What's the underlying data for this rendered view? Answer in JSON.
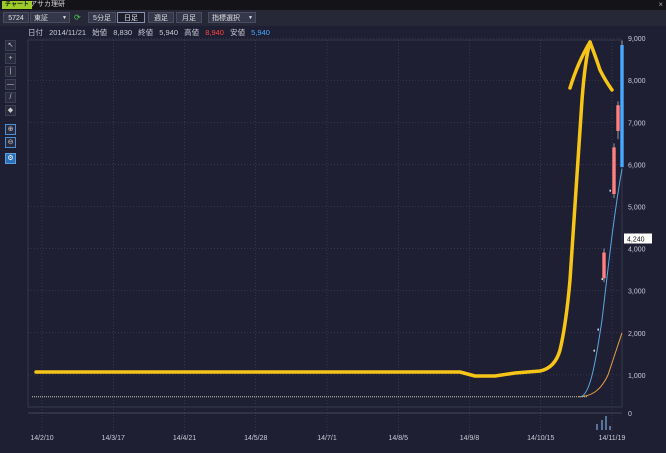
{
  "window": {
    "badge": "チャート",
    "title": "アサカ理研",
    "close_glyph": "×"
  },
  "toolbar": {
    "code": "5724",
    "market": "東証",
    "dropdown_glyph": "▼",
    "search_icon": "search-icon",
    "periods": [
      "5分足",
      "日足",
      "週足",
      "月足"
    ],
    "active_period": "日足",
    "indicator_label": "指標選択"
  },
  "info": {
    "date_label": "日付",
    "date": "2014/11/21",
    "open_label": "始値",
    "open": "8,830",
    "close_label": "終値",
    "close": "5,940",
    "high_label": "高値",
    "high": "8,940",
    "low_label": "安値",
    "low": "5,940"
  },
  "left_tools": [
    "cursor-icon",
    "crosshair-icon",
    "vertical-line-icon",
    "horizontal-line-icon",
    "trend-line-icon",
    "eraser-icon",
    "zoom-in-icon",
    "zoom-out-icon",
    "settings-icon"
  ],
  "colors": {
    "background": "#1e1f33",
    "high": "#ff4444",
    "low": "#49a9ff",
    "ma_short": "#5aa7e0",
    "ma_long": "#e8a040",
    "annotation": "#f7c518"
  },
  "current_price_label": "4,240",
  "chart_data": {
    "type": "candlestick",
    "x_ticks": [
      "14/2/10",
      "14/3/17",
      "14/4/21",
      "14/5/28",
      "14/7/1",
      "14/8/5",
      "14/9/8",
      "14/10/15",
      "14/11/19"
    ],
    "y_ticks": [
      "1,000",
      "2,000",
      "3,000",
      "4,000",
      "5,000",
      "6,000",
      "7,000",
      "8,000",
      "9,000"
    ],
    "volume_y_ticks": [
      "0"
    ],
    "ylim": [
      0,
      9000
    ],
    "baseline_price": 480,
    "last_candles": [
      {
        "date": "14/11/14",
        "open": 3300,
        "high": 4000,
        "low": 3200,
        "close": 3900
      },
      {
        "date": "14/11/17",
        "open": 5300,
        "high": 6500,
        "low": 5200,
        "close": 6400
      },
      {
        "date": "14/11/18",
        "open": 6800,
        "high": 7500,
        "low": 6600,
        "close": 7400
      },
      {
        "date": "14/11/21",
        "open": 8830,
        "high": 8940,
        "low": 5940,
        "close": 5940
      }
    ],
    "ma_short_end": 5900,
    "ma_long_end": 2000
  }
}
